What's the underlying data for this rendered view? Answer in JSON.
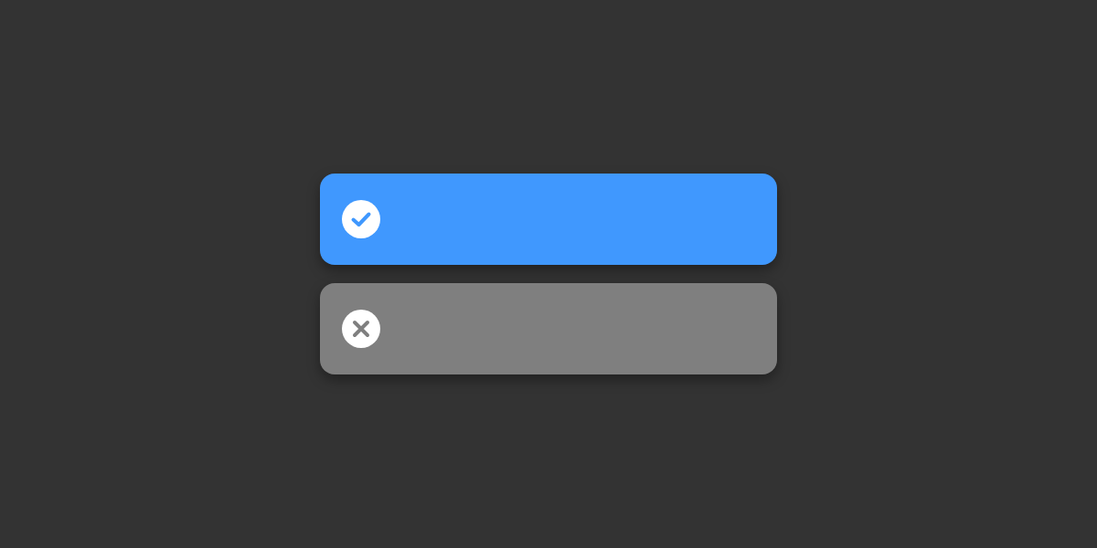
{
  "options": [
    {
      "selected": true
    },
    {
      "selected": false
    }
  ]
}
